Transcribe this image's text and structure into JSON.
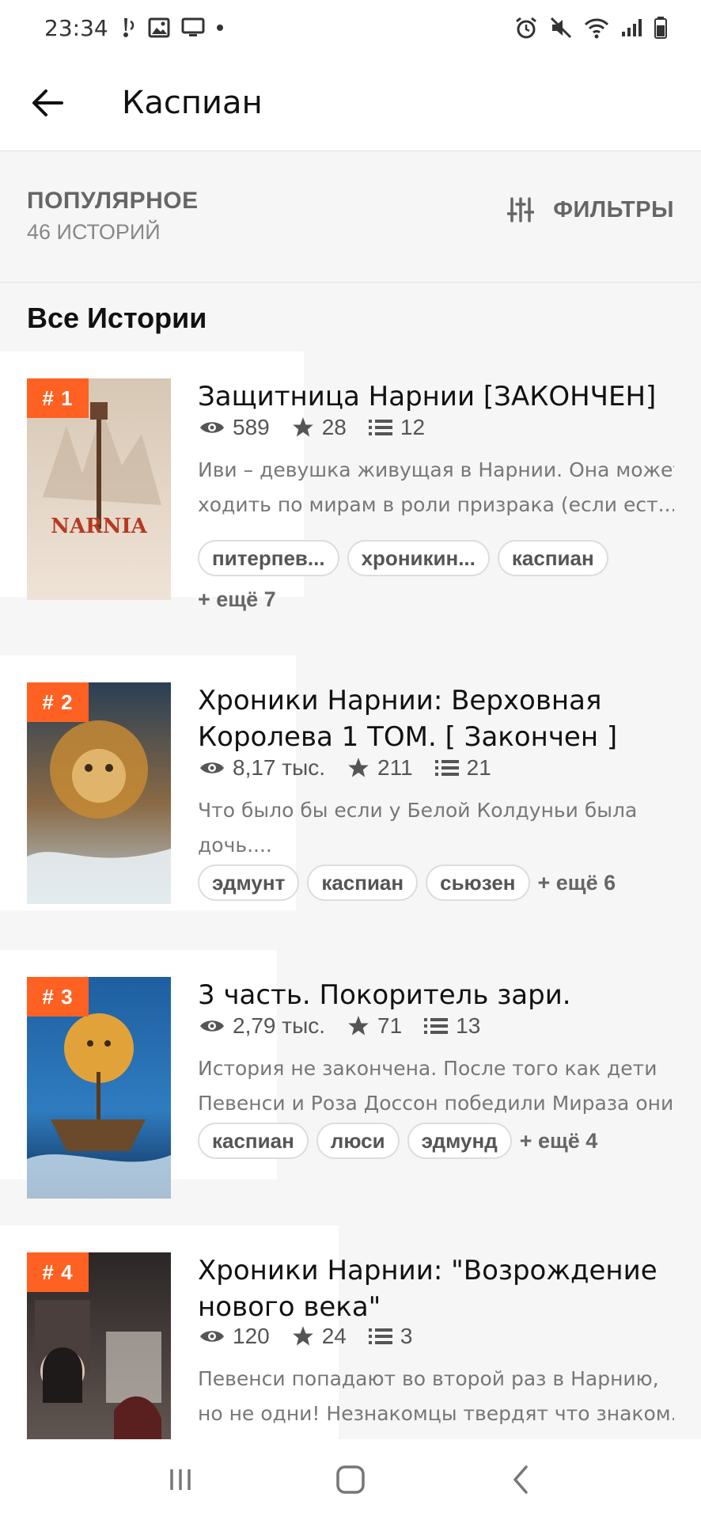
{
  "status_bar": {
    "time": "23:34",
    "left_icons": [
      "notification-dot-icon",
      "image-icon",
      "cast-icon"
    ],
    "right_icons": [
      "alarm-icon",
      "mute-icon",
      "wifi-icon",
      "signal-icon",
      "battery-icon"
    ]
  },
  "app_bar": {
    "title": "Каспиан",
    "back_icon": "arrow-left-icon"
  },
  "sort_bar": {
    "title": "ПОПУЛЯРНОЕ",
    "count": "46 ИСТОРИЙ",
    "filters_label": "ФИЛЬТРЫ",
    "filters_icon": "sliders-icon"
  },
  "section_title": "Все Истории",
  "colors": {
    "accent": "#ff6122",
    "background": "#f6f6f6",
    "text_primary": "#111111",
    "text_secondary": "#777777"
  },
  "stories": [
    {
      "rank": "# 1",
      "title_lines": [
        "Защитница Нарнии [ЗАКОНЧЕН]"
      ],
      "reads": "589",
      "votes": "28",
      "parts": "12",
      "description_lines": [
        "Иви – девушка живущая в Нарнии. Она может",
        "ходить по мирам в роли призрака (если ест..."
      ],
      "tags": [
        "питерпев...",
        "хроникин...",
        "каспиан"
      ],
      "more_tags": "+ ещё 7",
      "cover_colors": {
        "top": "#d7c7b4",
        "bottom": "#efe3d7",
        "accent": "#b63a22"
      }
    },
    {
      "rank": "# 2",
      "title_lines": [
        "Хроники Нарнии: Верховная",
        "Королева 1 ТОМ. [ Закончен ]"
      ],
      "reads": "8,17 тыс.",
      "votes": "211",
      "parts": "21",
      "description_lines": [
        "Что было бы если у Белой Колдуньи была",
        "дочь...."
      ],
      "tags": [
        "эдмунт",
        "каспиан",
        "сьюзен"
      ],
      "more_tags": "+ ещё 6",
      "cover_colors": {
        "top": "#2a3f55",
        "bottom": "#b7ccd8",
        "accent": "#c58a35"
      }
    },
    {
      "rank": "# 3",
      "title_lines": [
        "3 часть. Покоритель зари."
      ],
      "reads": "2,79 тыс.",
      "votes": "71",
      "parts": "13",
      "description_lines": [
        "История не закончена. После того как дети",
        "Певенси и Роза Доссон победили Мираза они..."
      ],
      "tags": [
        "каспиан",
        "люси",
        "эдмунд"
      ],
      "more_tags": "+ ещё 4",
      "cover_colors": {
        "top": "#1e5fa0",
        "bottom": "#0f2e55",
        "accent": "#e2a23a"
      }
    },
    {
      "rank": "# 4",
      "title_lines": [
        "Хроники Нарнии: \"Возрождение",
        "нового века\""
      ],
      "reads": "120",
      "votes": "24",
      "parts": "3",
      "description_lines": [
        "Певенси попадают во второй раз в Нарнию,",
        "но не одни! Незнакомцы твердят что знаком..."
      ],
      "tags": [],
      "more_tags": "",
      "cover_colors": {
        "top": "#2b2626",
        "bottom": "#6a5e58",
        "accent": "#d9d2cc"
      }
    }
  ],
  "nav_bar": {
    "recents_icon": "recents-icon",
    "home_icon": "home-icon",
    "back_icon": "back-icon"
  }
}
